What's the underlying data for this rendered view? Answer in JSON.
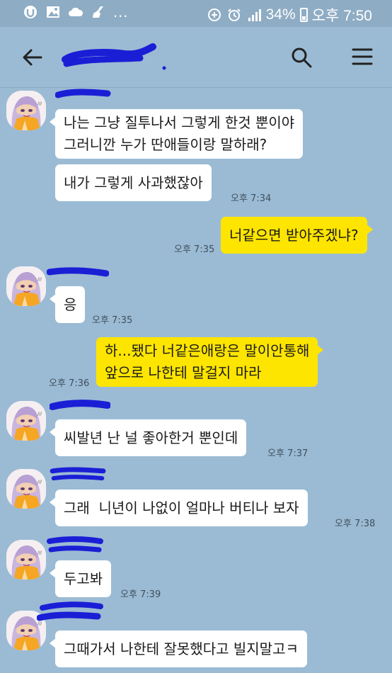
{
  "status_bar": {
    "battery": "34%",
    "time": "오후 7:50",
    "dots": "..."
  },
  "header": {
    "back_icon": "arrow-left-icon",
    "search_icon": "search-icon",
    "menu_icon": "hamburger-menu-icon"
  },
  "messages": [
    {
      "text": "나는 그냥 질투나서 그렇게 한것 뿐이야\n그러니깐 누가 딴애들이랑 말하래?",
      "time": ""
    },
    {
      "text": "내가 그렇게 사과했잖아",
      "time": "오후 7:34"
    },
    {
      "text": "너같으면 받아주겠냐?",
      "time": "오후 7:35"
    },
    {
      "text": "응",
      "time": "오후 7:35"
    },
    {
      "text": "하...됐다 너같은애랑은 말이안통해\n앞으로 나한테 말걸지 마라",
      "time": "오후 7:36"
    },
    {
      "text": "씨발년 난 널 좋아한거 뿐인데",
      "time": "오후 7:37"
    },
    {
      "text": "그래  니년이 나없이 얼마나 버티나 보자",
      "time": "오후 7:38"
    },
    {
      "text": "두고봐",
      "time": "오후 7:39"
    },
    {
      "text": "그때가서 나한테 잘못했다고 빌지말고ㅋ",
      "time": ""
    }
  ],
  "colors": {
    "background": "#9bbbd4",
    "incoming_bubble": "#ffffff",
    "outgoing_bubble": "#fee500",
    "redaction": "#1a1fd6"
  }
}
